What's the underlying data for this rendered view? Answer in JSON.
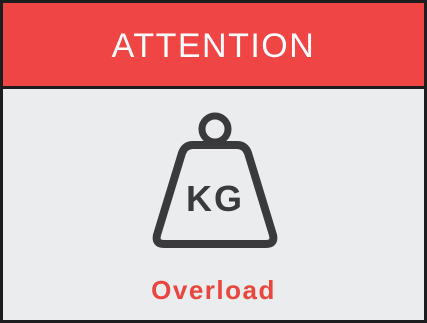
{
  "sign": {
    "header_title": "ATTENTION",
    "icon": "weight-kg-icon",
    "icon_label": "KG",
    "caption": "Overload"
  },
  "colors": {
    "header_background": "#f04545",
    "header_text": "#ffffff",
    "body_background": "#ebeced",
    "border": "#1d1d1f",
    "icon": "#3a3a3c",
    "caption": "#e8463f"
  }
}
